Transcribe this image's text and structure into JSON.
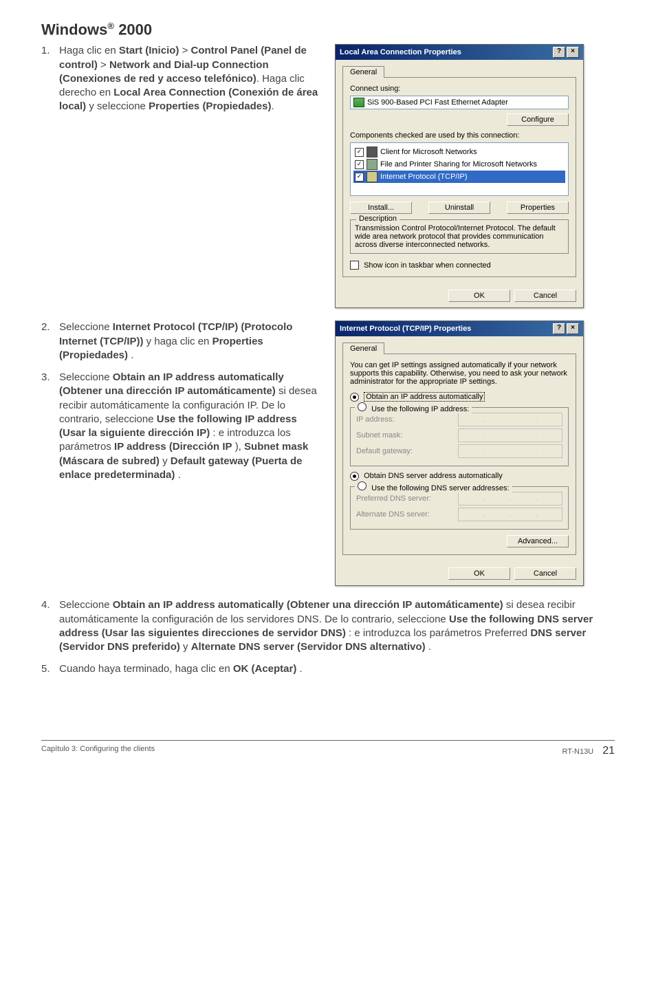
{
  "section_title_prefix": "Windows",
  "section_title_reg": "®",
  "section_title_suffix": " 2000",
  "step1": {
    "num": "1.",
    "t1": "Haga clic en ",
    "b1": "Start (Inicio)",
    "gt1": " > ",
    "b2": "Control Panel (Panel de control)",
    "gt2": " > ",
    "b3": "Network and Dial-up Connection (Conexiones de red y acceso telefónico)",
    "t2": ". Haga clic derecho en ",
    "b4": "Local Area Connection (Conexión de área local)",
    "t3": " y seleccione ",
    "b5": "Properties (Propiedades)",
    "t4": "."
  },
  "step2": {
    "num": "2.",
    "t1": "Seleccione ",
    "b1": "Internet Protocol (TCP/IP) (Protocolo Internet (TCP/IP))",
    "t2": " y haga clic en ",
    "b2": "Properties (Propiedades)",
    "t3": "."
  },
  "step3": {
    "num": "3.",
    "t1": "Seleccione ",
    "b1": "Obtain an IP address automatically (Obtener una dirección IP automáticamente)",
    "t2": " si desea recibir automáticamente la configuración IP. De lo contrario, seleccione ",
    "b2": "Use the following IP address (Usar la siguiente dirección IP)",
    "t3": ": e introduzca los parámetros ",
    "b3": "IP address (Dirección IP",
    "t4": "), ",
    "b4": "Subnet mask (Máscara de subred)",
    "t5": " y ",
    "b5": "Default gateway (Puerta de enlace predeterminada)",
    "t6": "."
  },
  "step4": {
    "num": "4.",
    "t1": "Seleccione ",
    "b1": "Obtain an IP address automatically (Obtener una dirección IP automáticamente)",
    "t2": " si desea recibir automáticamente la configuración de los servidores DNS. De lo contrario, seleccione ",
    "b2": "Use the following DNS server address (Usar las siguientes direcciones de servidor DNS)",
    "t3": ": e introduzca los parámetros Preferred ",
    "b3": "DNS server (Servidor DNS preferido)",
    "t4": " y ",
    "b4": "Alternate DNS server (Servidor DNS alternativo)",
    "t5": "."
  },
  "step5": {
    "num": "5.",
    "t1": "Cuando haya terminado, haga clic en ",
    "b1": "OK (Aceptar)",
    "t2": "."
  },
  "dlg1": {
    "title": "Local Area Connection Properties",
    "tab_general": "General",
    "connect_using": "Connect using:",
    "adapter": "SiS 900-Based PCI Fast Ethernet Adapter",
    "configure": "Configure",
    "components_label": "Components checked are used by this connection:",
    "item1": "Client for Microsoft Networks",
    "item2": "File and Printer Sharing for Microsoft Networks",
    "item3": "Internet Protocol (TCP/IP)",
    "install": "Install...",
    "uninstall": "Uninstall",
    "properties": "Properties",
    "desc_legend": "Description",
    "desc_text": "Transmission Control Protocol/Internet Protocol. The default wide area network protocol that provides communication across diverse interconnected networks.",
    "show_icon": "Show icon in taskbar when connected",
    "ok": "OK",
    "cancel": "Cancel",
    "help_btn": "?",
    "close_btn": "×"
  },
  "dlg2": {
    "title": "Internet Protocol (TCP/IP) Properties",
    "tab_general": "General",
    "intro": "You can get IP settings assigned automatically if your network supports this capability. Otherwise, you need to ask your network administrator for the appropriate IP settings.",
    "radio_obtain_ip": "Obtain an IP address automatically",
    "radio_use_ip": "Use the following IP address:",
    "ip_address": "IP address:",
    "subnet": "Subnet mask:",
    "gateway": "Default gateway:",
    "radio_obtain_dns": "Obtain DNS server address automatically",
    "radio_use_dns": "Use the following DNS server addresses:",
    "pref_dns": "Preferred DNS server:",
    "alt_dns": "Alternate DNS server:",
    "advanced": "Advanced...",
    "ok": "OK",
    "cancel": "Cancel",
    "help_btn": "?",
    "close_btn": "×"
  },
  "footer": {
    "left": "Capítulo 3: Configuring the clients",
    "model": "RT-N13U",
    "page": "21"
  }
}
